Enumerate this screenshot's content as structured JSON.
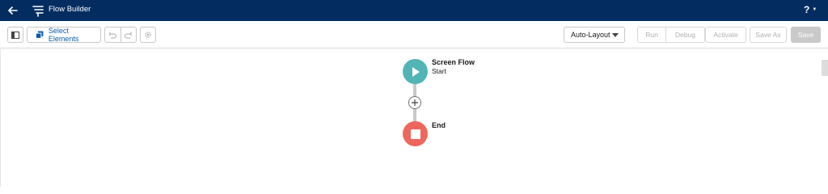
{
  "header": {
    "title": "Flow Builder",
    "back_icon": "arrow-left-icon",
    "help_label": "?",
    "background": "#032d60"
  },
  "toolbar": {
    "select_elements_label": "Select Elements",
    "layout_dropdown_value": "Auto-Layout",
    "run_label": "Run",
    "debug_label": "Debug",
    "activate_label": "Activate",
    "save_as_label": "Save As",
    "save_label": "Save",
    "accent": "#0b5cab"
  },
  "canvas": {
    "start_node": {
      "title": "Screen Flow",
      "subtitle": "Start",
      "color": "#52b4b5"
    },
    "end_node": {
      "title": "End",
      "color": "#f0665a"
    }
  }
}
